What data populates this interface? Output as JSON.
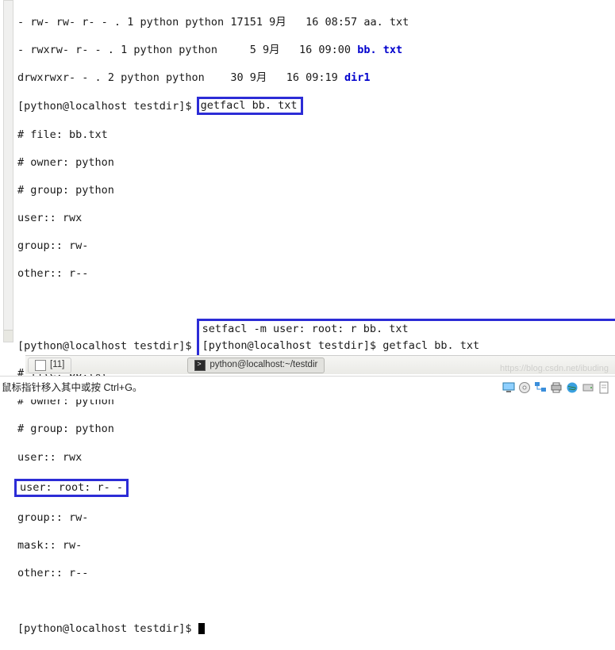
{
  "listing": [
    {
      "perms": "- rw- rw- r- - .",
      "links": "1",
      "owner": "python",
      "group": "python",
      "size": "17151",
      "month": "9月",
      "day": "16",
      "time": "08:57",
      "name": "aa. txt",
      "color": ""
    },
    {
      "perms": "- rwxrw- r- - .",
      "links": "1",
      "owner": "python",
      "group": "python",
      "size": "5",
      "month": "9月",
      "day": "16",
      "time": "09:00",
      "name": "bb. txt",
      "color": "blue"
    },
    {
      "perms": "drwxrwxr- - .",
      "links": "2",
      "owner": "python",
      "group": "python",
      "size": "30",
      "month": "9月",
      "day": "16",
      "time": "09:19",
      "name": "dir1",
      "color": "blue"
    }
  ],
  "prompt": "[python@localhost testdir]$",
  "cmd1": "getfacl bb. txt",
  "acl1": {
    "file": "# file: bb.txt",
    "owner": "# owner: python",
    "group": "# group: python",
    "user": "user:: rwx",
    "grp": "group:: rw-",
    "other": "other:: r--"
  },
  "cmd2": "setfacl -m user: root: r bb. txt",
  "cmd3": "getfacl bb. txt",
  "acl2": {
    "file": "# file: bb.txt",
    "owner": "# owner: python",
    "group": "# group: python",
    "user": "user:: rwx",
    "userroot": "user: root: r- -",
    "grp": "group:: rw-",
    "mask": "mask:: rw-",
    "other": "other:: r--"
  },
  "panel": {
    "task1": "[11]",
    "task2": "python@localhost:~/testdir"
  },
  "hint": "鼠标指针移入其中或按 Ctrl+G。",
  "watermark": "https://blog.csdn.net/ibuding"
}
